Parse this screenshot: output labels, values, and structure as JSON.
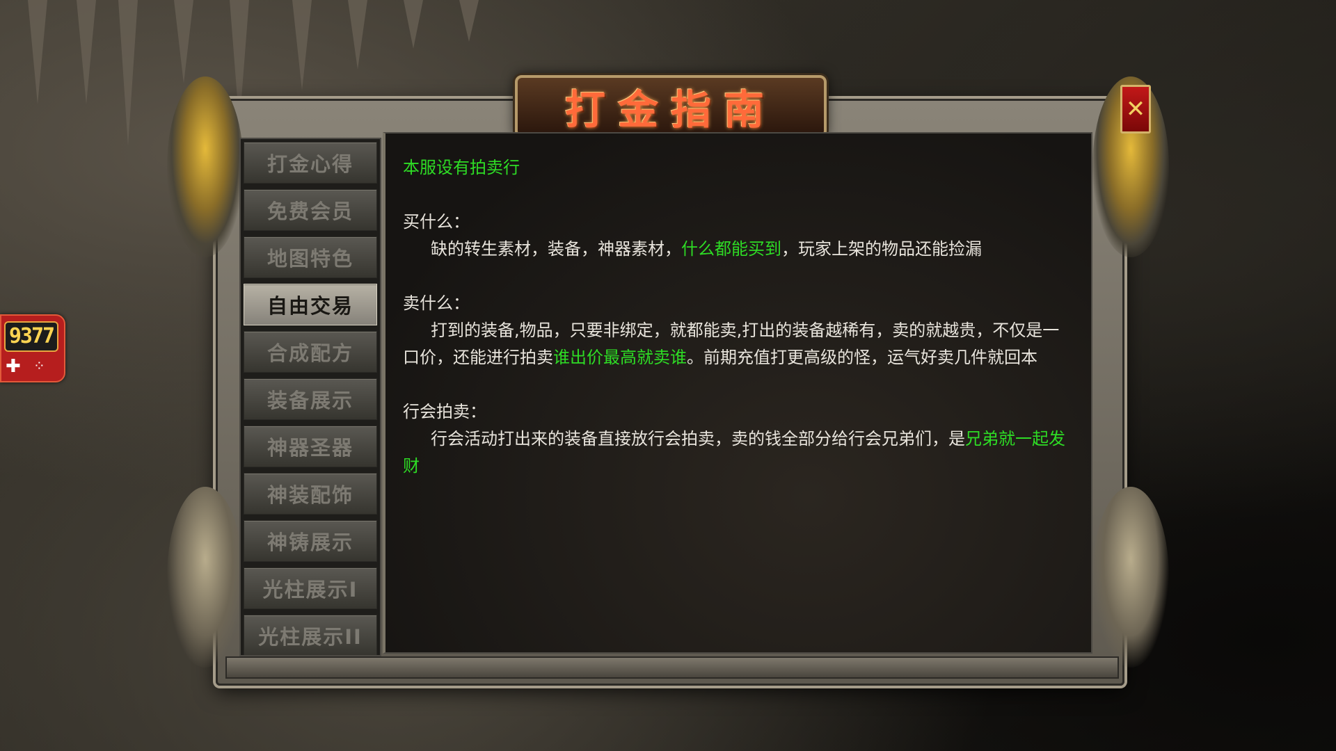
{
  "title": "打金指南",
  "close_label": "✕",
  "side_widget": {
    "number": "9377",
    "icon": "gamepad-icon"
  },
  "tabs": [
    {
      "label": "打金心得",
      "active": false
    },
    {
      "label": "免费会员",
      "active": false
    },
    {
      "label": "地图特色",
      "active": false
    },
    {
      "label": "自由交易",
      "active": true
    },
    {
      "label": "合成配方",
      "active": false
    },
    {
      "label": "装备展示",
      "active": false
    },
    {
      "label": "神器圣器",
      "active": false
    },
    {
      "label": "神装配饰",
      "active": false
    },
    {
      "label": "神铸展示",
      "active": false
    },
    {
      "label": "光柱展示I",
      "active": false
    },
    {
      "label": "光柱展示II",
      "active": false
    }
  ],
  "content": {
    "heading": "本服设有拍卖行",
    "buy": {
      "label": "买什么：",
      "text_1": "缺的转生素材，装备，神器素材，",
      "highlight": "什么都能买到",
      "text_2": "，玩家上架的物品还能捡漏"
    },
    "sell": {
      "label": "卖什么：",
      "text_1": "打到的装备,物品，只要非绑定，就都能卖,打出的装备越稀有，卖的就越贵，不仅是一口价，还能进行拍卖",
      "highlight": "谁出价最高就卖谁",
      "text_2": "。前期充值打更高级的怪，运气好卖几件就回本"
    },
    "guild": {
      "label": "行会拍卖：",
      "text_1": "行会活动打出来的装备直接放行会拍卖，卖的钱全部分给行会兄弟们，是",
      "highlight": "兄弟就一起发财"
    }
  },
  "colors": {
    "highlight_green": "#2edc25",
    "title_red": "#ff6a3a",
    "close_red": "#c21818"
  }
}
